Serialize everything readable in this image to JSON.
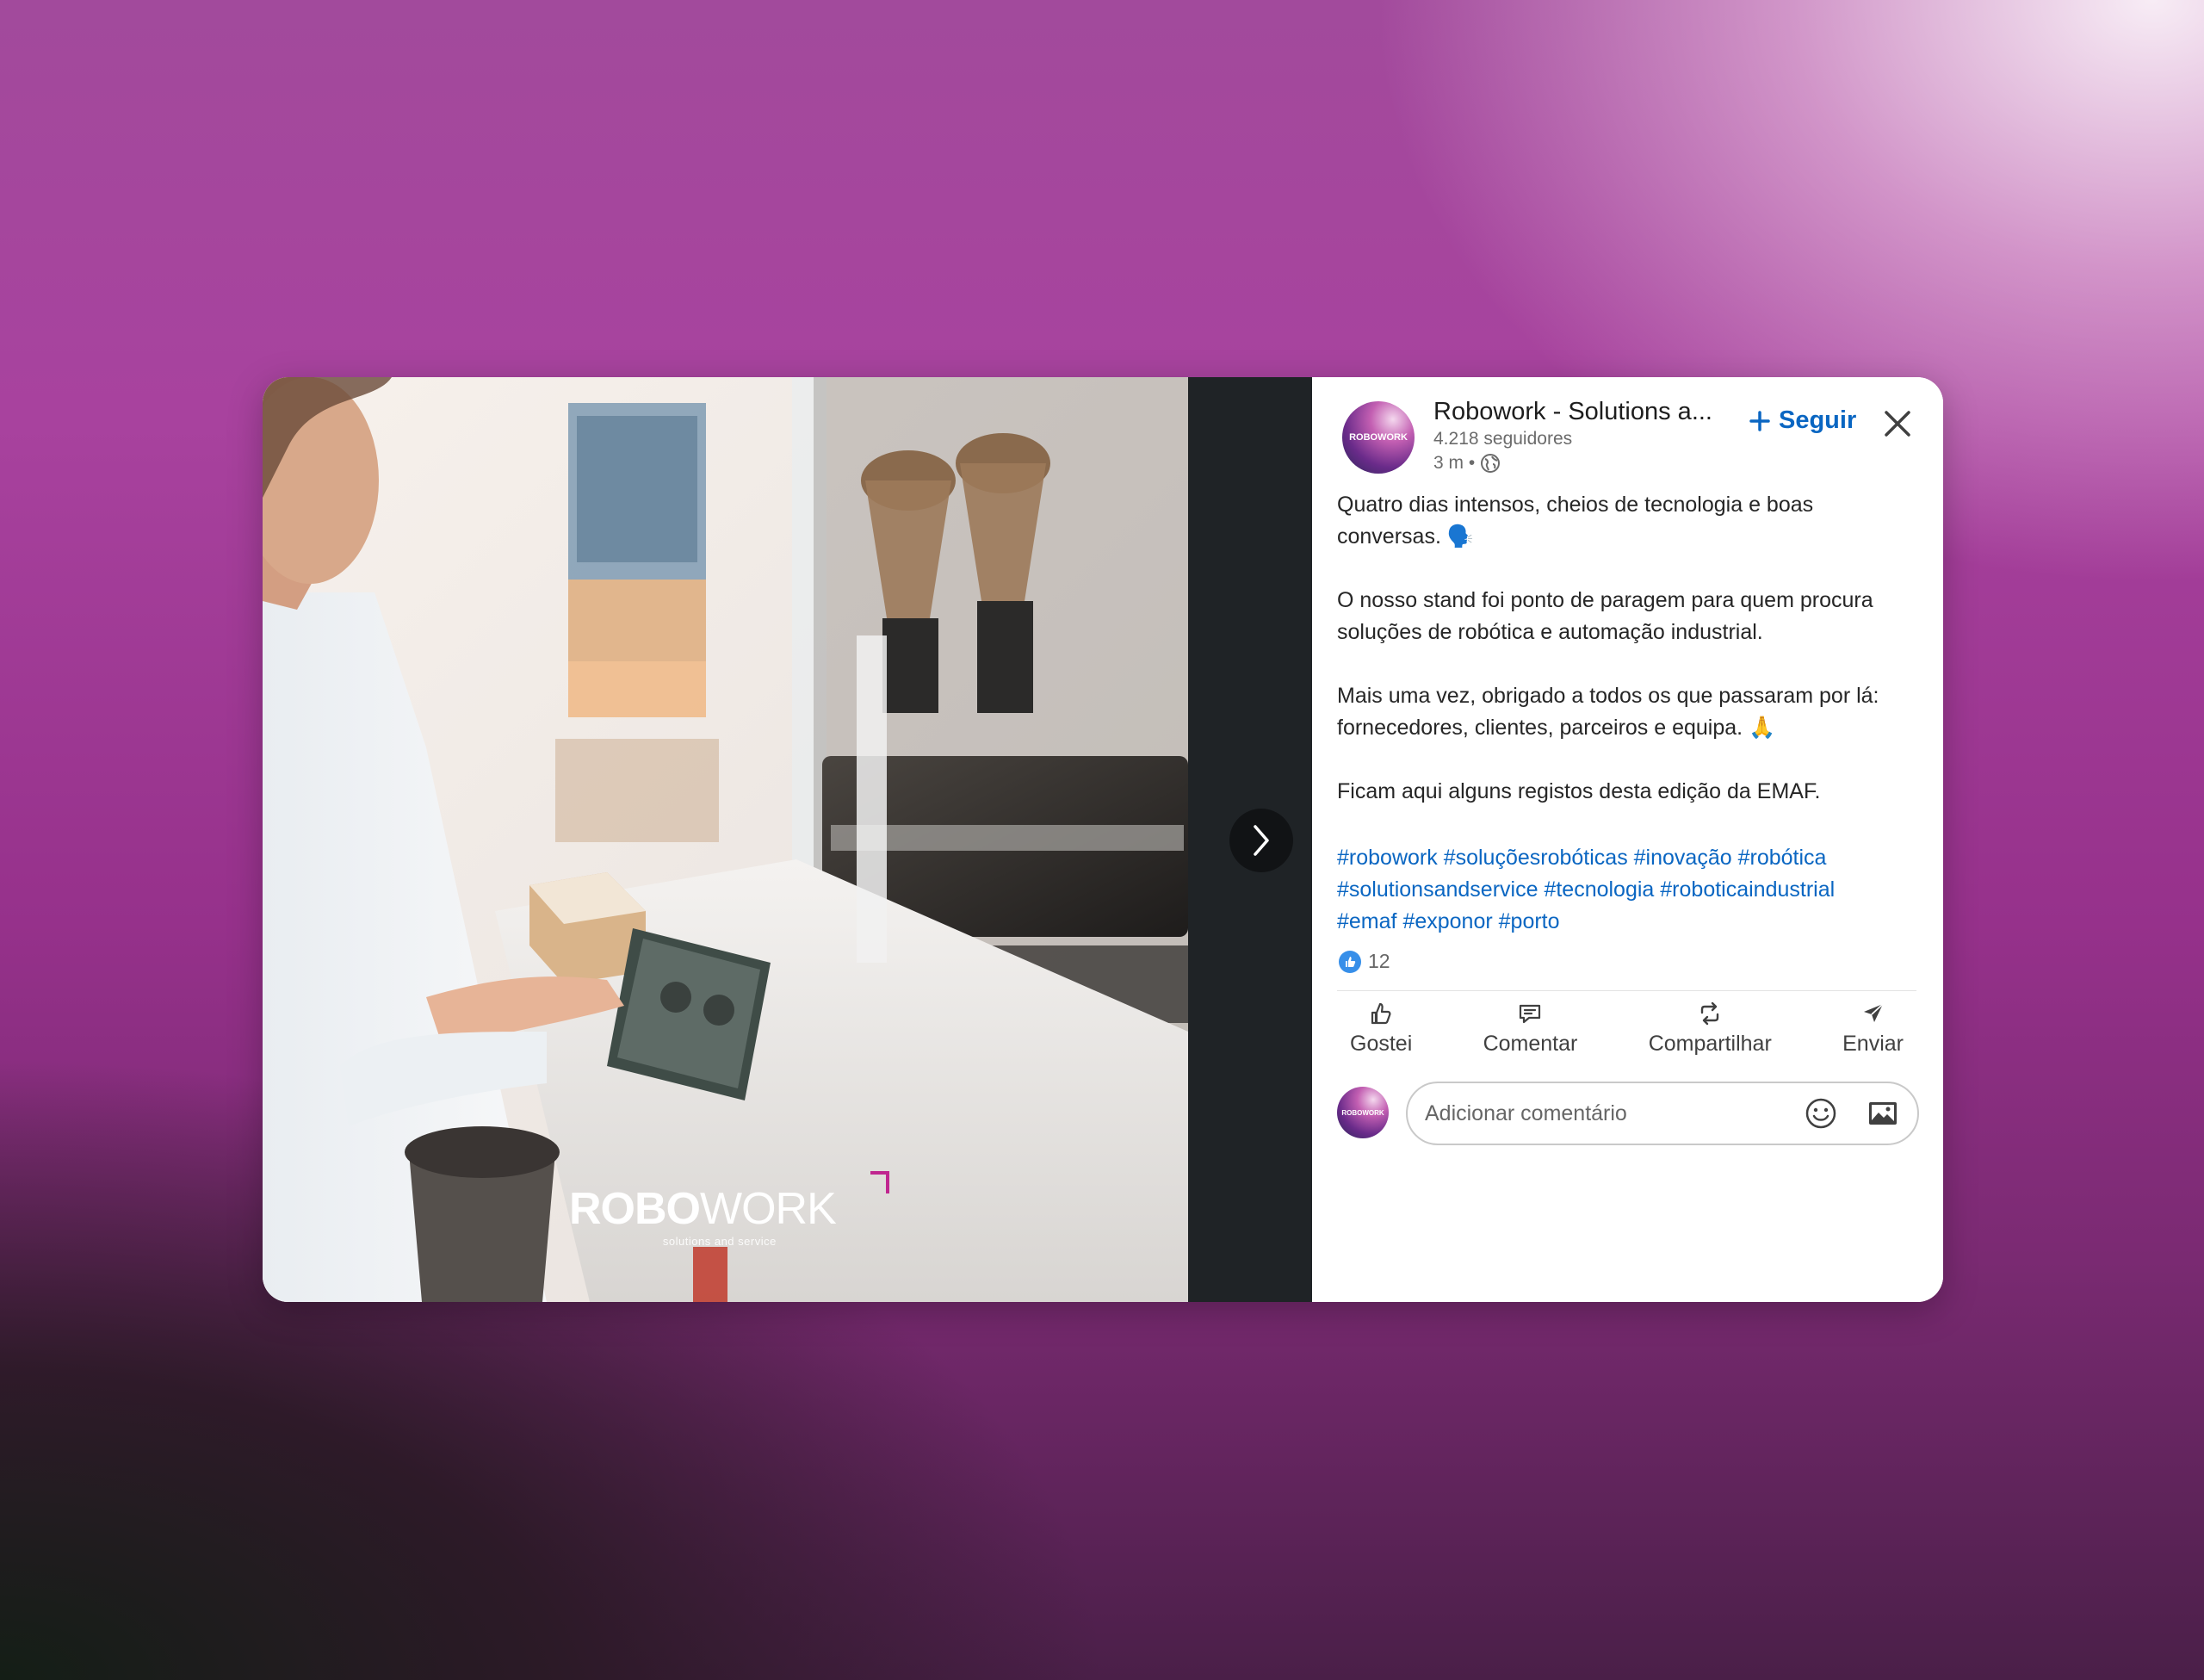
{
  "post": {
    "author": {
      "name": "Robowork - Solutions a...",
      "followers": "4.218 seguidores",
      "time": "3 m •",
      "avatar_text": "ROBOWORK"
    },
    "follow_label": "Seguir",
    "paragraphs": [
      "Quatro dias intensos, cheios de tecnologia e boas conversas. 🗣️",
      "O nosso stand foi ponto de paragem para quem procura soluções de robótica e automação industrial.",
      "Mais uma vez, obrigado a todos os que passaram por lá: fornecedores, clientes, parceiros e equipa. 🙏",
      "Ficam aqui alguns registos desta edição da EMAF."
    ],
    "hashtags": [
      "#robowork",
      "#soluçõesrobóticas",
      "#inovação",
      "#robótica",
      "#solutionsandservice",
      "#tecnologia",
      "#roboticaindustrial",
      "#emaf",
      "#exponor",
      "#porto"
    ],
    "reactions_count": "12"
  },
  "media": {
    "watermark_bold": "ROBO",
    "watermark_light": "WORK",
    "watermark_sub": "solutions and service"
  },
  "actions": [
    {
      "label": "Gostei",
      "icon": "like-icon"
    },
    {
      "label": "Comentar",
      "icon": "comment-icon"
    },
    {
      "label": "Compartilhar",
      "icon": "repost-icon"
    },
    {
      "label": "Enviar",
      "icon": "send-icon"
    }
  ],
  "comment": {
    "placeholder": "Adicionar comentário",
    "avatar_text": "ROBOWORK"
  },
  "colors": {
    "link_blue": "#0a66c2",
    "brand_magenta": "#c0268f"
  }
}
